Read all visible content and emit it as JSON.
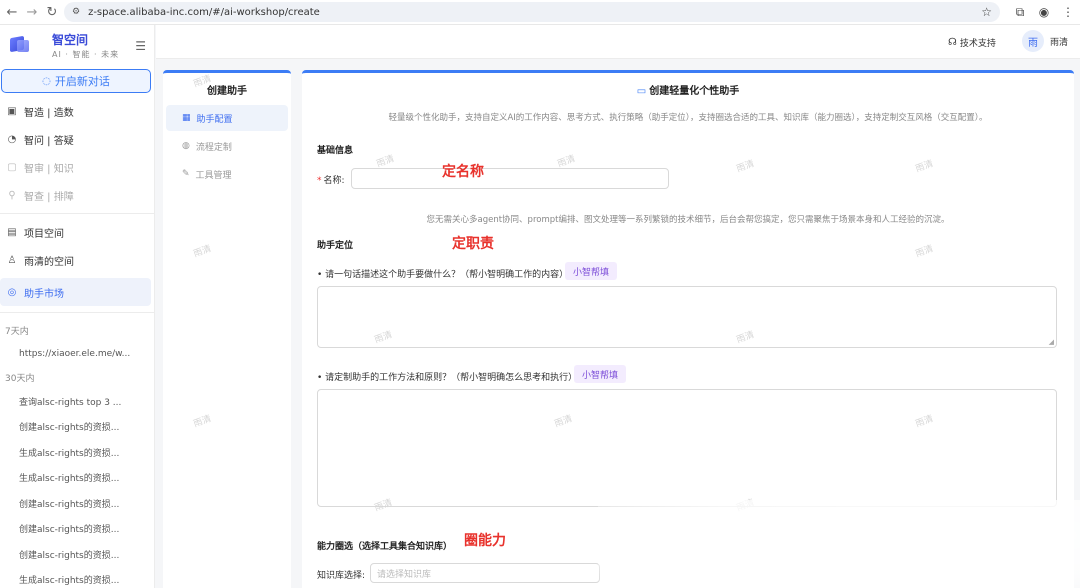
{
  "browser": {
    "url": "z-space.alibaba-inc.com/#/ai-workshop/create"
  },
  "sidebar": {
    "app_title": "智空间",
    "app_subtitle": "AI · 智能 · 未来",
    "new_chat_label": "开启新对话",
    "items": [
      {
        "label": "智造 | 造数",
        "icon": "screen-icon",
        "state": "normal"
      },
      {
        "label": "智问 | 答疑",
        "icon": "chat-icon",
        "state": "normal"
      },
      {
        "label": "智审 | 知识",
        "icon": "doc-icon",
        "state": "disabled"
      },
      {
        "label": "智查 | 排障",
        "icon": "search-icon",
        "state": "disabled"
      },
      {
        "label": "项目空间",
        "icon": "project-icon",
        "state": "normal"
      },
      {
        "label": "雨清的空间",
        "icon": "user-icon",
        "state": "normal"
      },
      {
        "label": "助手市场",
        "icon": "market-icon",
        "state": "active"
      }
    ],
    "history": [
      {
        "title": "7天内",
        "entries": [
          "https://xiaoer.ele.me/w..."
        ]
      },
      {
        "title": "30天内",
        "entries": [
          "查询alsc-rights top 3 ...",
          "创建alsc-rights的资损...",
          "生成alsc-rights的资损...",
          "生成alsc-rights的资损...",
          "创建alsc-rights的资损...",
          "创建alsc-rights的资损...",
          "创建alsc-rights的资损...",
          "生成alsc-rights的资损..."
        ]
      }
    ]
  },
  "header": {
    "support_label": "技术支持",
    "avatar_text": "雨",
    "user_name": "雨清"
  },
  "steps": {
    "title": "创建助手",
    "items": [
      {
        "label": "助手配置",
        "state": "active"
      },
      {
        "label": "流程定制",
        "state": "inactive"
      },
      {
        "label": "工具管理",
        "state": "inactive"
      }
    ]
  },
  "form": {
    "title": "创建轻量化个性助手",
    "description": "轻量级个性化助手，支持自定义AI的工作内容、思考方式、执行策略（助手定位），支持圈选合适的工具、知识库（能力圈选），支持定制交互风格（交互配置）。",
    "basic_section": "基础信息",
    "name_label": "名称:",
    "name_value": "",
    "hint": "您无需关心多agent协同、prompt编排、图文处理等一系列繁锁的技术细节，后台会帮您搞定，您只需聚焦于场景本身和人工经验的沉淀。",
    "position_section": "助手定位",
    "q1_label": "• 请一句话描述这个助手要做什么？（帮小智明确工作的内容）",
    "q1_helper": "小智帮填",
    "q1_value": "",
    "q2_label": "• 请定制助手的工作方法和原则？（帮小智明确怎么思考和执行）",
    "q2_helper": "小智帮填",
    "q2_value": "",
    "capability_section": "能力圈选（选择工具集合知识库）",
    "kb_label": "知识库选择:",
    "kb_placeholder": "请选择知识库"
  },
  "annotations": {
    "name": "定名称",
    "duty": "定职责",
    "capability": "圈能力"
  },
  "watermark": "雨清",
  "colors": {
    "accent": "#3c7cf5",
    "annotation": "#e8322c",
    "helper_bg": "#f3ecfe",
    "helper_text": "#7b4bd8"
  }
}
